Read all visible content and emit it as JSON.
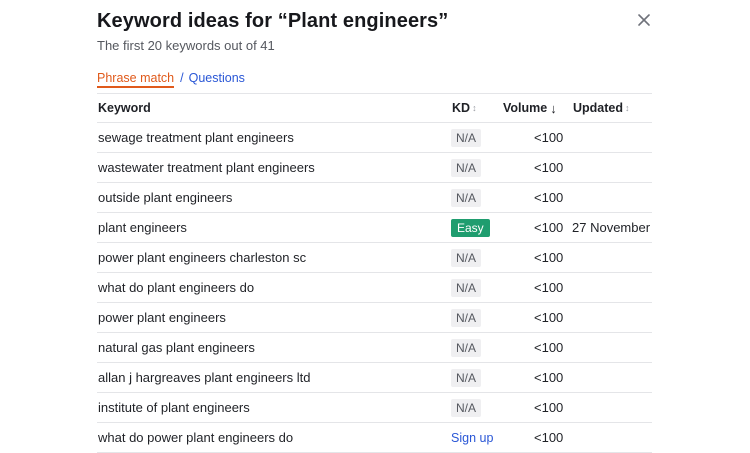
{
  "header": {
    "title": "Keyword ideas for “Plant engineers”",
    "subtitle": "The first 20 keywords out of 41"
  },
  "tabs": {
    "active": "Phrase match",
    "separator": "/",
    "other": "Questions"
  },
  "colors": {
    "accent_tab": "#e05a1b",
    "link": "#2a57d6",
    "easy_badge": "#1f9d6f"
  },
  "table": {
    "columns": {
      "keyword": "Keyword",
      "kd": "KD",
      "volume": "Volume",
      "updated": "Updated"
    },
    "rows": [
      {
        "keyword": "sewage treatment plant engineers",
        "kd": "N/A",
        "kd_type": "na",
        "volume": "<100",
        "updated": ""
      },
      {
        "keyword": "wastewater treatment plant engineers",
        "kd": "N/A",
        "kd_type": "na",
        "volume": "<100",
        "updated": ""
      },
      {
        "keyword": "outside plant engineers",
        "kd": "N/A",
        "kd_type": "na",
        "volume": "<100",
        "updated": ""
      },
      {
        "keyword": "plant engineers",
        "kd": "Easy",
        "kd_type": "easy",
        "volume": "<100",
        "updated": "27 November"
      },
      {
        "keyword": "power plant engineers charleston sc",
        "kd": "N/A",
        "kd_type": "na",
        "volume": "<100",
        "updated": ""
      },
      {
        "keyword": "what do plant engineers do",
        "kd": "N/A",
        "kd_type": "na",
        "volume": "<100",
        "updated": ""
      },
      {
        "keyword": "power plant engineers",
        "kd": "N/A",
        "kd_type": "na",
        "volume": "<100",
        "updated": ""
      },
      {
        "keyword": "natural gas plant engineers",
        "kd": "N/A",
        "kd_type": "na",
        "volume": "<100",
        "updated": ""
      },
      {
        "keyword": "allan j hargreaves plant engineers ltd",
        "kd": "N/A",
        "kd_type": "na",
        "volume": "<100",
        "updated": ""
      },
      {
        "keyword": "institute of plant engineers",
        "kd": "N/A",
        "kd_type": "na",
        "volume": "<100",
        "updated": ""
      },
      {
        "keyword": "what do power plant engineers do",
        "kd": "Sign up",
        "kd_type": "signup",
        "volume": "<100",
        "updated": ""
      }
    ]
  }
}
